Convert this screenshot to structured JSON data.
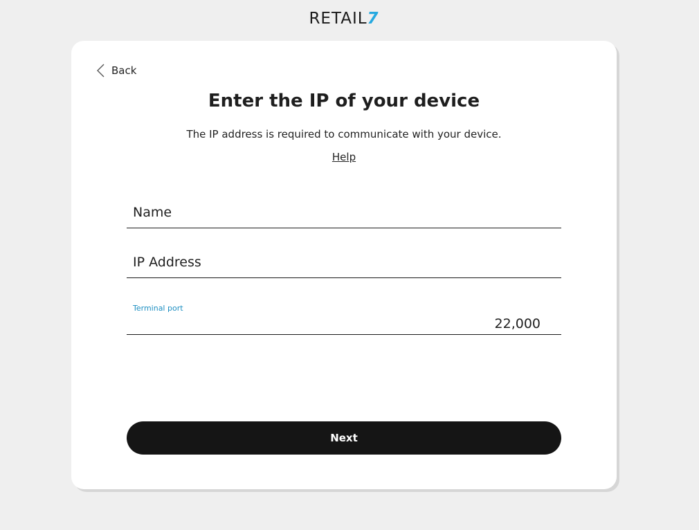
{
  "brand": {
    "logo_text": "RETAIL",
    "logo_accent": "7",
    "accent_color": "#26a9e0"
  },
  "nav": {
    "back_label": "Back"
  },
  "header": {
    "title": "Enter the IP of your device",
    "subtitle": "The IP address is required to communicate with your device.",
    "help_link": "Help"
  },
  "form": {
    "name": {
      "placeholder": "Name",
      "value": ""
    },
    "ip": {
      "placeholder": "IP Address",
      "value": ""
    },
    "port": {
      "label": "Terminal port",
      "value": "22,000"
    }
  },
  "actions": {
    "next_label": "Next"
  },
  "colors": {
    "background": "#efefef",
    "card": "#ffffff",
    "button": "#151515",
    "label": "#1c8ec1"
  }
}
